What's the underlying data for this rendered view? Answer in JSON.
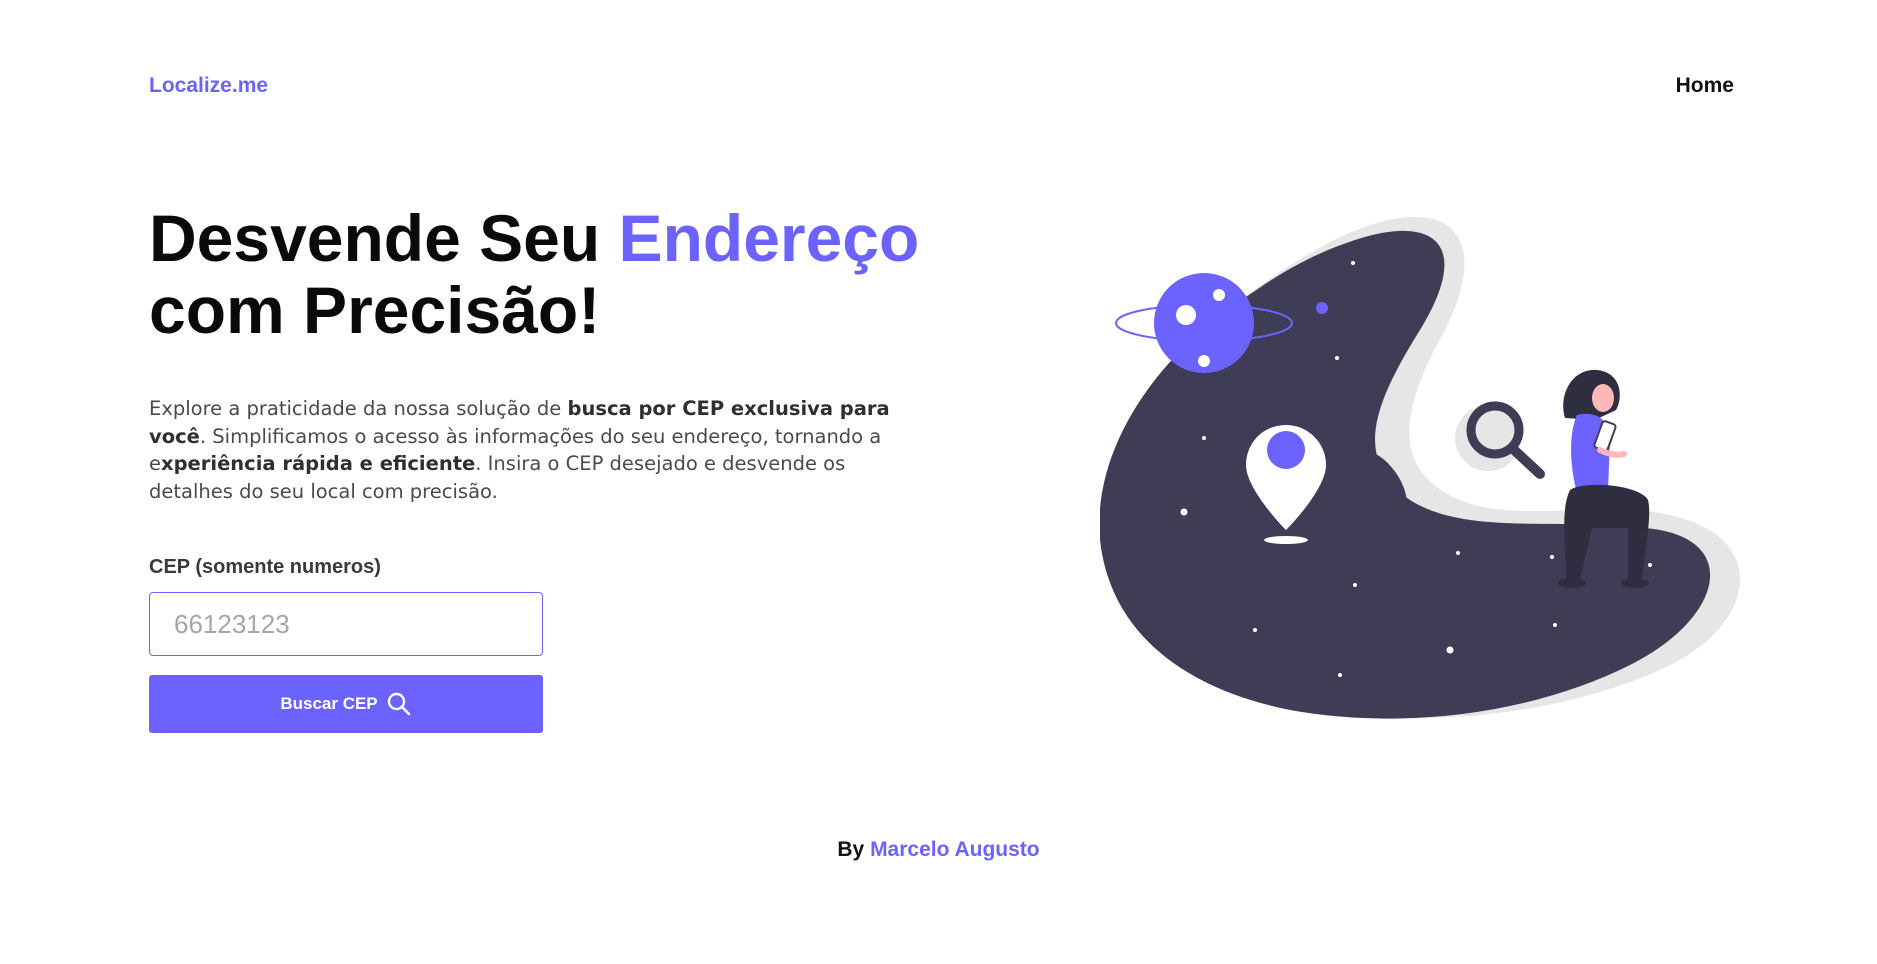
{
  "header": {
    "logo": "Localize.me",
    "nav": {
      "home": "Home"
    }
  },
  "hero": {
    "title_part1": "Desvende Seu ",
    "title_accent": "Endereço",
    "title_part2": "com Precisão!",
    "intro": {
      "t1": "Explore a praticidade da nossa solução de ",
      "b1": "busca por CEP exclusiva para você",
      "t2": ". Simplificamos o acesso às informações do seu endereço, tornando a e",
      "b2": "xperiência rápida e eficiente",
      "t3": ". Insira o CEP desejado e desvende os detalhes do seu local com precisão."
    }
  },
  "form": {
    "cep_label": "CEP (somente numeros)",
    "cep_placeholder": "66123123",
    "cep_value": "",
    "search_button": "Buscar CEP"
  },
  "footer": {
    "by": "By",
    "author": "Marcelo Augusto"
  },
  "colors": {
    "accent": "#6c63ff",
    "illustration_dark": "#3f3d56",
    "illustration_shadow": "#e6e6e6"
  },
  "icons": [
    "search-icon"
  ]
}
